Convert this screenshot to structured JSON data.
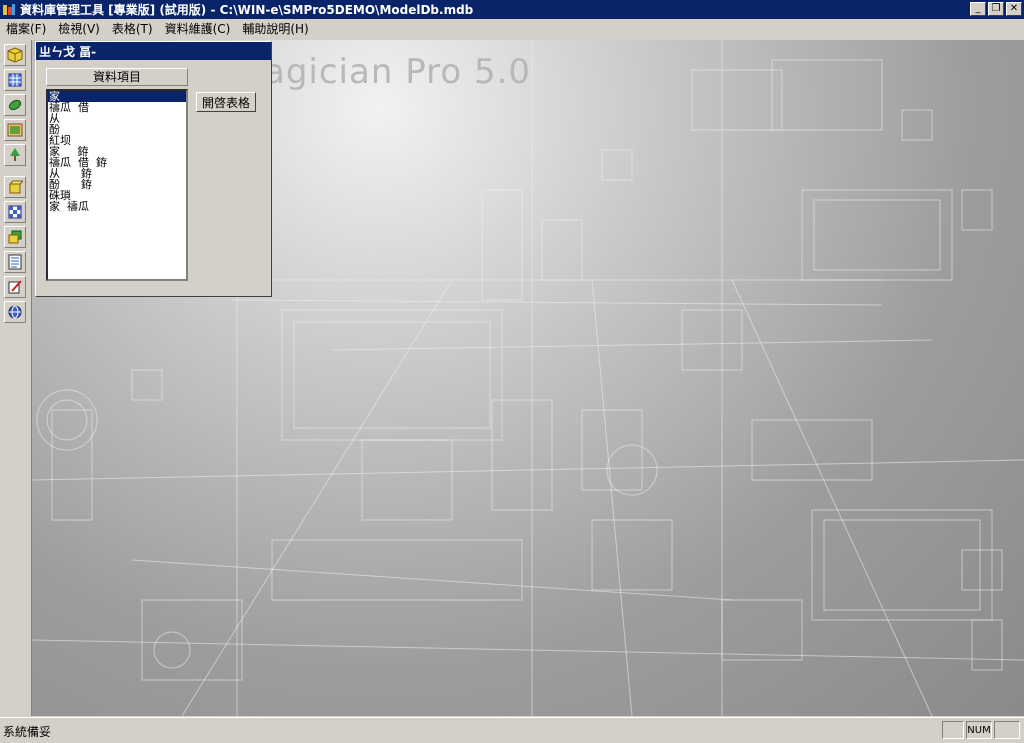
{
  "window": {
    "title": "資料庫管理工具 [專業版] (試用版) - C:\\WIN-e\\SMPro5DEMO\\ModelDb.mdb",
    "minimize_label": "_",
    "restore_label": "❐",
    "close_label": "✕"
  },
  "menu": {
    "items": [
      {
        "label": "檔案(F)"
      },
      {
        "label": "檢視(V)"
      },
      {
        "label": "表格(T)"
      },
      {
        "label": "資料維護(C)"
      },
      {
        "label": "輔助說明(H)"
      }
    ]
  },
  "toolbar": {
    "icons": [
      "cube-icon",
      "grid-icon",
      "leaf-icon",
      "picture-icon",
      "tree-icon",
      "box-icon",
      "checker-icon",
      "layers-icon",
      "list-icon",
      "pen-icon",
      "globe-icon"
    ]
  },
  "background": {
    "brand_text": "agician Pro 5.0"
  },
  "panel": {
    "title": "ㄓㄣ戈 畐-",
    "group_header": "資料項目",
    "open_button": "開啓表格",
    "items": [
      "家",
      "禱瓜  借",
      "从",
      "酚",
      "紅坝",
      "家     銌",
      "禱瓜  借  銌",
      "从      銌",
      "酚      銌",
      "硃瑣",
      "家  禱瓜"
    ],
    "selected_index": 0
  },
  "status": {
    "text": "系統備妥",
    "num": "NUM"
  },
  "colors": {
    "titlebar": "#0a246a",
    "face": "#d4d0c8",
    "selection": "#0a246a"
  }
}
